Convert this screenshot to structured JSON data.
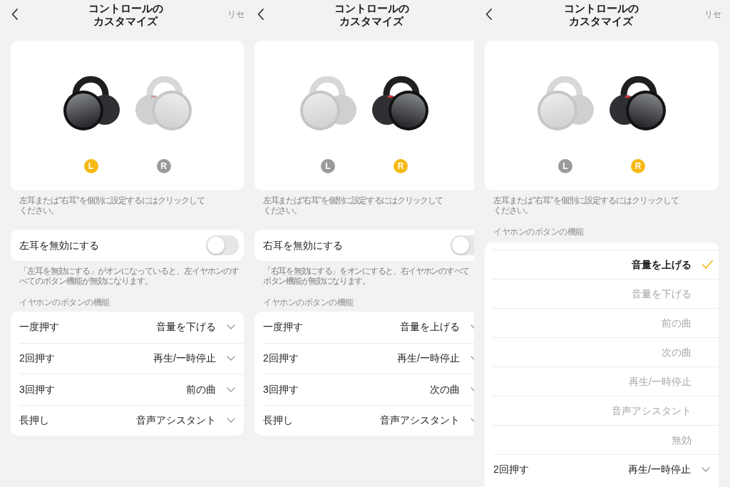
{
  "panels": [
    {
      "title_lines": [
        "コントロールの",
        "カスタマイズ"
      ],
      "reset": "リセ",
      "earbuds": [
        {
          "label": "L",
          "selected": true
        },
        {
          "label": "R",
          "selected": false
        }
      ],
      "hint_lines": [
        "左耳または\"右耳\"を個別に設定するにはクリックして",
        "ください。"
      ],
      "disable_toggle": {
        "label": "左耳を無効にする",
        "on": false
      },
      "toggle_note_lines": [
        "「左耳を無効にする」がオンになっていると、左イヤホンのす",
        "べてのボタン機能が無効になります。"
      ],
      "section_label": "イヤホンのボタンの機能",
      "actions": [
        {
          "gesture": "一度押す",
          "function": "音量を下げる"
        },
        {
          "gesture": "2回押す",
          "function": "再生/一時停止"
        },
        {
          "gesture": "3回押す",
          "function": "前の曲"
        },
        {
          "gesture": "長押し",
          "function": "音声アシスタント"
        }
      ]
    },
    {
      "title_lines": [
        "コントロールの",
        "カスタマイズ"
      ],
      "earbuds": [
        {
          "label": "L",
          "selected": false
        },
        {
          "label": "R",
          "selected": true
        }
      ],
      "hint_lines": [
        "左耳または\"右耳\"を個別に設定するにはクリックして",
        "ください。"
      ],
      "disable_toggle": {
        "label": "右耳を無効にする",
        "on": false
      },
      "toggle_note_lines": [
        "「右耳を無効にする」をオンにすると、右イヤホンのすべて",
        "ボタン機能が無効になります。"
      ],
      "section_label": "イヤホンのボタンの機能",
      "actions": [
        {
          "gesture": "一度押す",
          "function": "音量を上げる"
        },
        {
          "gesture": "2回押す",
          "function": "再生/一時停止"
        },
        {
          "gesture": "3回押す",
          "function": "次の曲"
        },
        {
          "gesture": "長押し",
          "function": "音声アシスタント"
        }
      ]
    },
    {
      "title_lines": [
        "コントロールの",
        "カスタマイズ"
      ],
      "reset": "リセ",
      "earbuds": [
        {
          "label": "L",
          "selected": false
        },
        {
          "label": "R",
          "selected": true
        }
      ],
      "hint_lines": [
        "左耳または\"右耳\"を個別に設定するにはクリックして",
        "ください。"
      ],
      "section_label": "イヤホンのボタンの機能",
      "function_options": [
        {
          "label": "音量を上げる",
          "selected": true
        },
        {
          "label": "音量を下げる",
          "selected": false
        },
        {
          "label": "前の曲",
          "selected": false
        },
        {
          "label": "次の曲",
          "selected": false
        },
        {
          "label": "再生/一時停止",
          "selected": false
        },
        {
          "label": "音声アシスタント",
          "selected": false
        },
        {
          "label": "無効",
          "selected": false
        }
      ],
      "actions": [
        {
          "gesture": "2回押す",
          "function": "再生/一時停止"
        }
      ]
    }
  ]
}
